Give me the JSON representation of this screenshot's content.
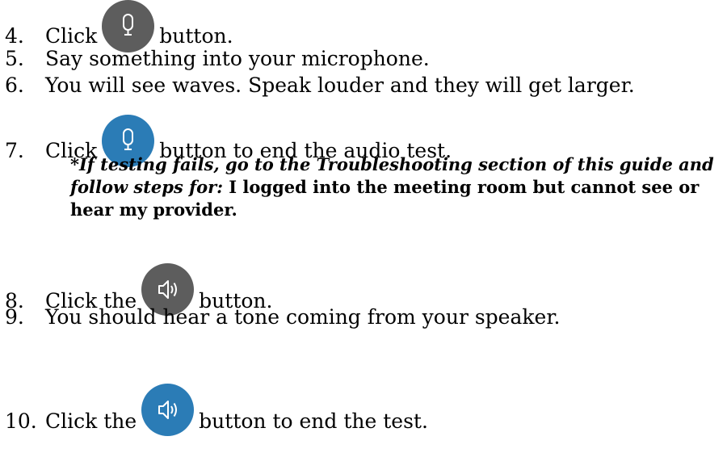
{
  "steps": [
    {
      "num": "4.",
      "before": "Click",
      "after": "button.",
      "icon": "microphone-icon"
    },
    {
      "num": "5.",
      "text": "Say something into your microphone."
    },
    {
      "num": "6.",
      "text": "You will see waves.  Speak louder and they will get larger."
    },
    {
      "num": "7.",
      "before": "Click",
      "after": "button to end the audio test.",
      "icon": "microphone-icon"
    },
    {
      "num": "8.",
      "before": "Click the",
      "after": "button.",
      "icon": "speaker-icon"
    },
    {
      "num": "9.",
      "text": "You should hear a tone coming from your speaker."
    },
    {
      "num": "10.",
      "before": "Click the",
      "after": "button to end the test.",
      "icon": "speaker-icon"
    }
  ],
  "note": {
    "italic_1": "*If testing fails, go to the Troubleshooting section of this guide and",
    "italic_2": "follow steps for:",
    "bold_2": "I logged into the meeting room but cannot see or",
    "bold_3": "hear my provider."
  },
  "colors": {
    "gray_button": "#5d5d5d",
    "blue_button": "#2b7cb6",
    "icon_stroke": "#ffffff"
  }
}
